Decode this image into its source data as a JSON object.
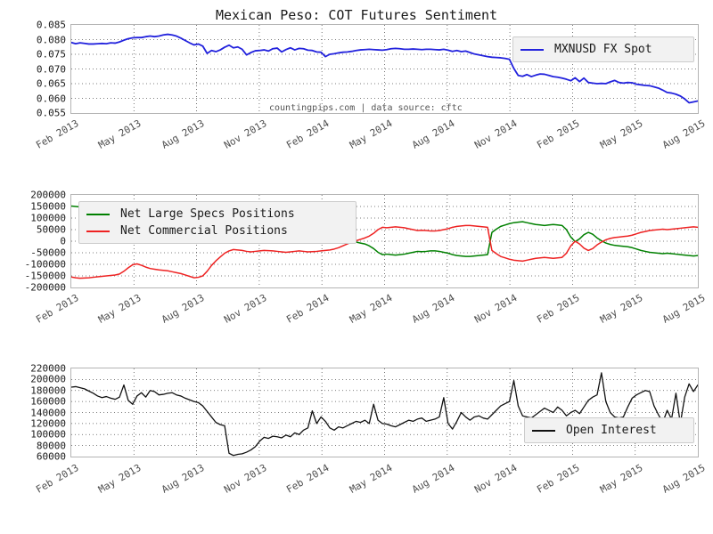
{
  "figure": {
    "title": "Mexican Peso: COT Futures Sentiment",
    "watermark": "countingpips.com | data source: cftc",
    "background": "#ffffff",
    "frame_color": "#b4b4b4",
    "grid_color": "#555555"
  },
  "xaxis": {
    "ticks": [
      "Feb 2013",
      "May 2013",
      "Aug 2013",
      "Nov 2013",
      "Feb 2014",
      "May 2014",
      "Aug 2014",
      "Nov 2014",
      "Feb 2015",
      "May 2015",
      "Aug 2015"
    ],
    "rotation_deg": -30
  },
  "chart_data": [
    {
      "id": "fx-spot",
      "type": "line",
      "title": "Mexican Peso: COT Futures Sentiment",
      "xlabel": "",
      "ylabel": "",
      "grid": true,
      "legend_position": "upper right",
      "ylim": [
        0.055,
        0.085
      ],
      "ytick_labels": [
        "0.085",
        "0.080",
        "0.075",
        "0.070",
        "0.065",
        "0.060",
        "0.055"
      ],
      "ytick_values": [
        0.085,
        0.08,
        0.075,
        0.07,
        0.065,
        0.06,
        0.055
      ],
      "categories": [
        "Feb 2013",
        "May 2013",
        "Aug 2013",
        "Nov 2013",
        "Feb 2014",
        "May 2014",
        "Aug 2014",
        "Nov 2014",
        "Feb 2015",
        "May 2015",
        "Aug 2015"
      ],
      "series": [
        {
          "name": "MXNUSD FX Spot",
          "color": "#2222dd",
          "values": [
            0.079,
            0.0786,
            0.0789,
            0.0787,
            0.0785,
            0.0785,
            0.0786,
            0.0787,
            0.0786,
            0.0789,
            0.0788,
            0.0792,
            0.0798,
            0.0803,
            0.0806,
            0.0807,
            0.0807,
            0.081,
            0.0812,
            0.081,
            0.0812,
            0.0816,
            0.0818,
            0.0816,
            0.0812,
            0.0805,
            0.0797,
            0.0789,
            0.0782,
            0.0785,
            0.0778,
            0.0753,
            0.0763,
            0.0759,
            0.0765,
            0.0774,
            0.0781,
            0.0772,
            0.0775,
            0.0767,
            0.0748,
            0.0756,
            0.0762,
            0.0763,
            0.0765,
            0.0761,
            0.0769,
            0.0771,
            0.0758,
            0.0766,
            0.0772,
            0.0765,
            0.077,
            0.0769,
            0.0764,
            0.0763,
            0.0758,
            0.0757,
            0.0742,
            0.075,
            0.0752,
            0.0755,
            0.0757,
            0.0758,
            0.076,
            0.0763,
            0.0765,
            0.0766,
            0.0767,
            0.0766,
            0.0765,
            0.0764,
            0.0766,
            0.0769,
            0.077,
            0.0769,
            0.0767,
            0.0767,
            0.0768,
            0.0767,
            0.0766,
            0.0767,
            0.0767,
            0.0766,
            0.0765,
            0.0767,
            0.0764,
            0.076,
            0.0763,
            0.0759,
            0.0761,
            0.0756,
            0.0751,
            0.0748,
            0.0745,
            0.0742,
            0.074,
            0.0739,
            0.0738,
            0.0736,
            0.0733,
            0.0702,
            0.0678,
            0.0675,
            0.0681,
            0.0674,
            0.0679,
            0.0683,
            0.0682,
            0.0678,
            0.0674,
            0.0672,
            0.0669,
            0.0665,
            0.066,
            0.067,
            0.0657,
            0.0669,
            0.0654,
            0.0652,
            0.065,
            0.0651,
            0.065,
            0.0656,
            0.0661,
            0.0654,
            0.0652,
            0.0654,
            0.0653,
            0.0648,
            0.0646,
            0.0644,
            0.0643,
            0.0639,
            0.0635,
            0.0628,
            0.062,
            0.0618,
            0.0614,
            0.0608,
            0.0598,
            0.0585,
            0.0588,
            0.0591
          ]
        }
      ],
      "legend": [
        {
          "label": "MXNUSD FX Spot",
          "color": "#2222dd"
        }
      ]
    },
    {
      "id": "net-positions",
      "type": "line",
      "title": "",
      "xlabel": "",
      "ylabel": "",
      "grid": true,
      "legend_position": "upper left",
      "ylim": [
        -200000,
        200000
      ],
      "ytick_labels": [
        "200000",
        "150000",
        "100000",
        "50000",
        "0",
        "-50000",
        "-100000",
        "-150000",
        "-200000"
      ],
      "ytick_values": [
        200000,
        150000,
        100000,
        50000,
        0,
        -50000,
        -100000,
        -150000,
        -200000
      ],
      "categories": [
        "Feb 2013",
        "May 2013",
        "Aug 2013",
        "Nov 2013",
        "Feb 2014",
        "May 2014",
        "Aug 2014",
        "Nov 2014",
        "Feb 2015",
        "May 2015",
        "Aug 2015"
      ],
      "series": [
        {
          "name": "Net Large Specs Positions",
          "color": "#008000",
          "values": [
            152000,
            150000,
            148000,
            150000,
            152000,
            150000,
            147000,
            143000,
            140000,
            142000,
            145000,
            140000,
            132000,
            120000,
            105000,
            96000,
            101000,
            108000,
            115000,
            118000,
            120000,
            122000,
            124000,
            128000,
            130000,
            132000,
            136000,
            140000,
            144000,
            140000,
            132000,
            110000,
            88000,
            70000,
            56000,
            42000,
            34000,
            30000,
            33000,
            36000,
            40000,
            42000,
            40000,
            38000,
            36000,
            37000,
            38000,
            40000,
            42000,
            44000,
            42000,
            40000,
            38000,
            40000,
            42000,
            41000,
            40000,
            38000,
            36000,
            34000,
            30000,
            24000,
            16000,
            8000,
            2000,
            -4000,
            -8000,
            -12000,
            -20000,
            -32000,
            -48000,
            -58000,
            -56000,
            -58000,
            -60000,
            -58000,
            -56000,
            -52000,
            -48000,
            -44000,
            -45000,
            -44000,
            -42000,
            -42000,
            -44000,
            -48000,
            -52000,
            -58000,
            -62000,
            -64000,
            -66000,
            -66000,
            -64000,
            -62000,
            -60000,
            -58000,
            38000,
            52000,
            64000,
            70000,
            76000,
            80000,
            82000,
            84000,
            80000,
            76000,
            72000,
            70000,
            68000,
            70000,
            72000,
            70000,
            68000,
            50000,
            18000,
            -2000,
            10000,
            28000,
            38000,
            30000,
            14000,
            2000,
            -8000,
            -14000,
            -18000,
            -20000,
            -22000,
            -24000,
            -28000,
            -34000,
            -40000,
            -44000,
            -48000,
            -50000,
            -52000,
            -54000,
            -52000,
            -54000,
            -56000,
            -58000,
            -60000,
            -62000,
            -64000,
            -62000
          ]
        },
        {
          "name": "Net Commercial Positions",
          "color": "#ee2222",
          "values": [
            -155000,
            -158000,
            -160000,
            -159000,
            -158000,
            -156000,
            -154000,
            -152000,
            -150000,
            -148000,
            -146000,
            -142000,
            -130000,
            -115000,
            -102000,
            -98000,
            -104000,
            -112000,
            -118000,
            -121000,
            -124000,
            -126000,
            -128000,
            -132000,
            -136000,
            -140000,
            -146000,
            -152000,
            -158000,
            -156000,
            -150000,
            -130000,
            -105000,
            -85000,
            -68000,
            -52000,
            -42000,
            -36000,
            -38000,
            -40000,
            -44000,
            -46000,
            -44000,
            -42000,
            -40000,
            -41000,
            -42000,
            -44000,
            -46000,
            -48000,
            -46000,
            -44000,
            -42000,
            -44000,
            -46000,
            -45000,
            -44000,
            -42000,
            -40000,
            -38000,
            -34000,
            -28000,
            -20000,
            -12000,
            -4000,
            2000,
            8000,
            14000,
            22000,
            34000,
            50000,
            60000,
            58000,
            60000,
            62000,
            60000,
            58000,
            54000,
            50000,
            46000,
            47000,
            46000,
            44000,
            44000,
            46000,
            50000,
            54000,
            60000,
            64000,
            66000,
            68000,
            68000,
            66000,
            64000,
            62000,
            60000,
            -40000,
            -54000,
            -66000,
            -72000,
            -78000,
            -82000,
            -84000,
            -86000,
            -82000,
            -78000,
            -74000,
            -72000,
            -70000,
            -72000,
            -74000,
            -72000,
            -70000,
            -52000,
            -20000,
            0,
            -12000,
            -30000,
            -40000,
            -32000,
            -16000,
            -4000,
            6000,
            12000,
            16000,
            18000,
            20000,
            22000,
            26000,
            32000,
            38000,
            42000,
            46000,
            48000,
            50000,
            52000,
            50000,
            52000,
            54000,
            56000,
            58000,
            60000,
            62000,
            60000
          ]
        }
      ],
      "legend": [
        {
          "label": "Net Large Specs Positions",
          "color": "#008000"
        },
        {
          "label": "Net Commercial Positions",
          "color": "#ee2222"
        }
      ]
    },
    {
      "id": "open-interest",
      "type": "line",
      "title": "",
      "xlabel": "",
      "ylabel": "",
      "grid": true,
      "legend_position": "lower right",
      "ylim": [
        60000,
        220000
      ],
      "ytick_labels": [
        "220000",
        "200000",
        "180000",
        "160000",
        "140000",
        "120000",
        "100000",
        "80000",
        "60000"
      ],
      "ytick_values": [
        220000,
        200000,
        180000,
        160000,
        140000,
        120000,
        100000,
        80000,
        60000
      ],
      "categories": [
        "Feb 2013",
        "May 2013",
        "Aug 2013",
        "Nov 2013",
        "Feb 2014",
        "May 2014",
        "Aug 2014",
        "Nov 2014",
        "Feb 2015",
        "May 2015",
        "Aug 2015"
      ],
      "series": [
        {
          "name": "Open Interest",
          "color": "#111111",
          "values": [
            186000,
            187000,
            185000,
            183000,
            179000,
            175000,
            170000,
            167000,
            169000,
            166000,
            164000,
            168000,
            190000,
            162000,
            155000,
            170000,
            176000,
            168000,
            180000,
            178000,
            172000,
            173000,
            175000,
            176000,
            172000,
            170000,
            166000,
            163000,
            160000,
            158000,
            152000,
            142000,
            132000,
            122000,
            118000,
            116000,
            66000,
            62000,
            64000,
            65000,
            68000,
            72000,
            78000,
            88000,
            95000,
            93000,
            97000,
            96000,
            94000,
            99000,
            96000,
            103000,
            100000,
            108000,
            112000,
            143000,
            120000,
            132000,
            124000,
            112000,
            108000,
            114000,
            112000,
            116000,
            120000,
            124000,
            122000,
            126000,
            120000,
            155000,
            126000,
            120000,
            119000,
            116000,
            114000,
            118000,
            122000,
            126000,
            124000,
            128000,
            130000,
            124000,
            126000,
            128000,
            132000,
            167000,
            120000,
            110000,
            124000,
            140000,
            132000,
            126000,
            132000,
            134000,
            130000,
            128000,
            136000,
            144000,
            152000,
            156000,
            160000,
            198000,
            152000,
            134000,
            132000,
            130000,
            136000,
            142000,
            148000,
            144000,
            140000,
            150000,
            144000,
            134000,
            140000,
            144000,
            138000,
            150000,
            162000,
            168000,
            172000,
            212000,
            160000,
            140000,
            132000,
            130000,
            132000,
            150000,
            166000,
            172000,
            176000,
            180000,
            178000,
            152000,
            136000,
            122000,
            144000,
            128000,
            175000,
            120000,
            168000,
            192000,
            178000,
            190000
          ]
        }
      ],
      "legend": [
        {
          "label": "Open Interest",
          "color": "#111111"
        }
      ]
    }
  ]
}
